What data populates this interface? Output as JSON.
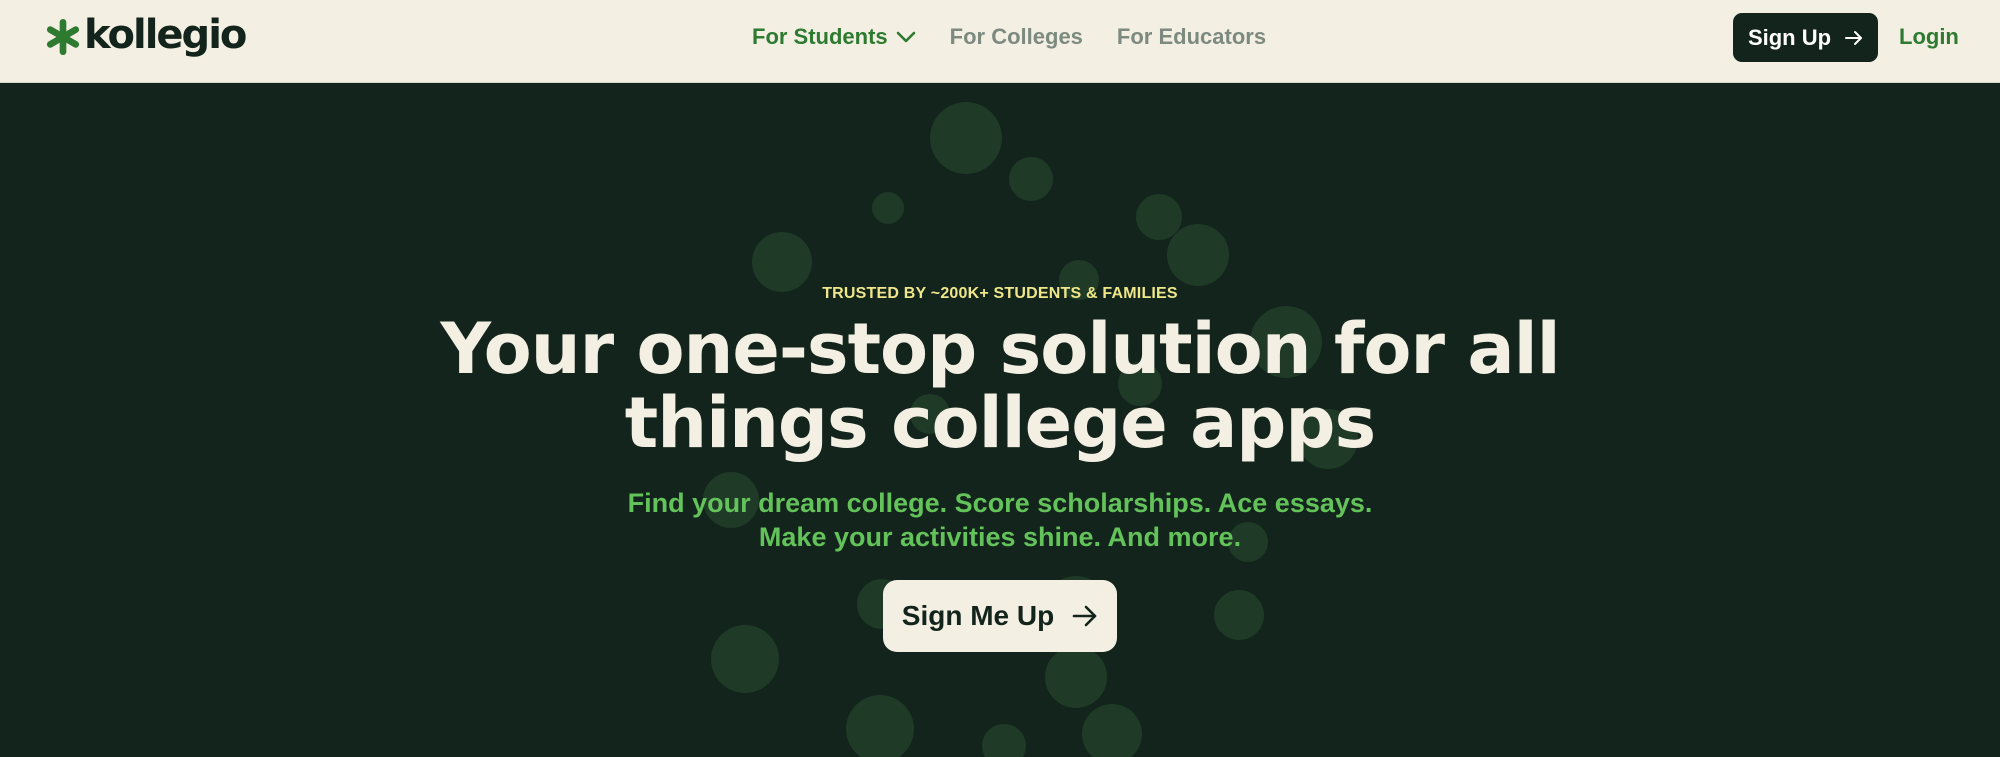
{
  "header": {
    "logo_text": "kollegio",
    "nav": [
      {
        "label": "For Students",
        "active": true,
        "has_dropdown": true,
        "icon": "chevron-down-icon"
      },
      {
        "label": "For Colleges",
        "active": false
      },
      {
        "label": "For Educators",
        "active": false
      }
    ],
    "signup_label": "Sign Up",
    "signup_icon": "arrow-right-icon",
    "login_label": "Login"
  },
  "hero": {
    "eyebrow": "TRUSTED BY ~200K+ STUDENTS & FAMILIES",
    "headline_line1": "Your one-stop solution for all",
    "headline_line2": "things college apps",
    "subheadline_line1": "Find your dream college. Score scholarships. Ace essays.",
    "subheadline_line2": "Make your activities shine. And more.",
    "cta_label": "Sign Me Up",
    "cta_icon": "arrow-right-icon"
  },
  "colors": {
    "dark_green": "#12241b",
    "cream": "#f4efe3",
    "nav_active": "#2d7a30",
    "nav_inactive": "#7c8a80",
    "eyebrow_yellow": "#efe78a",
    "subheadline_green": "#63c25a",
    "bubble": "#1f3a27"
  }
}
